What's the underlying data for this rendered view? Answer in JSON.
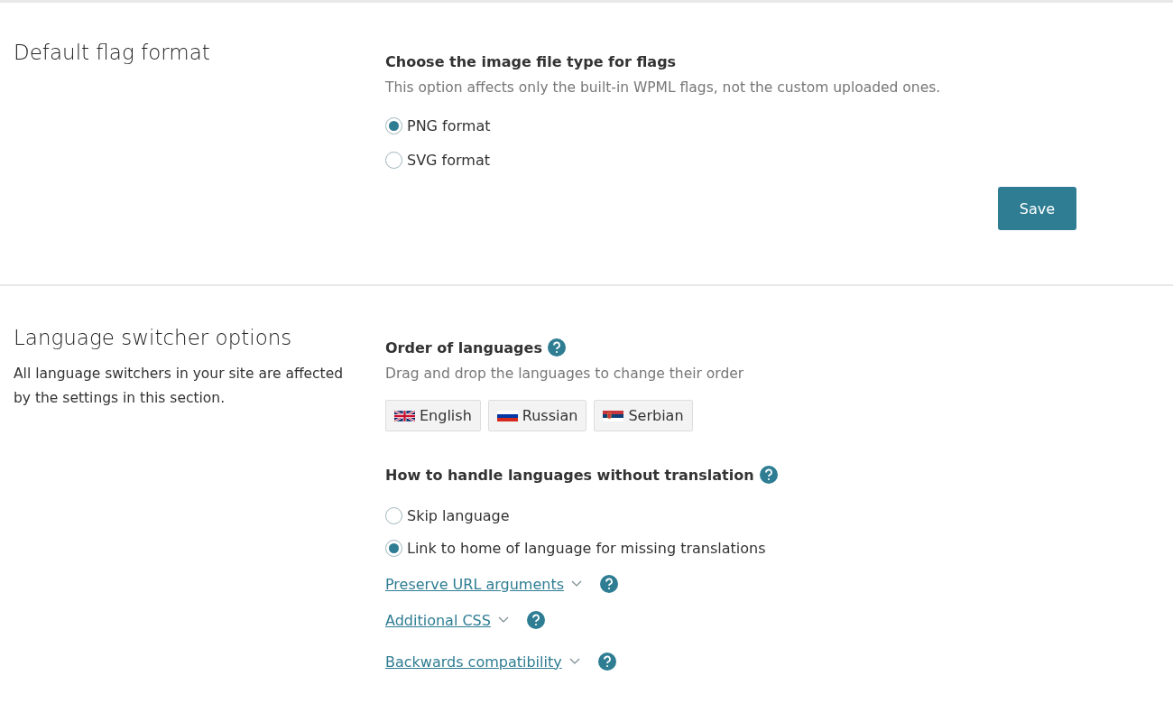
{
  "sections": [
    {
      "title": "Default flag format",
      "kind": "flag_format",
      "heading": "Choose the image file type for flags",
      "hint": "This option affects only the built-in WPML flags, not the custom uploaded ones.",
      "options": [
        {
          "label": "PNG format",
          "selected": true
        },
        {
          "label": "SVG format",
          "selected": false
        }
      ],
      "button": "Save"
    },
    {
      "title": "Language switcher options",
      "description": "All language switchers in your site are affected by the settings in this section.",
      "kind": "switcher",
      "order_heading": "Order of languages",
      "order_hint": "Drag and drop the languages to change their order",
      "languages": [
        {
          "name": "English",
          "kind": "uk"
        },
        {
          "name": "Russian",
          "kind": "ru"
        },
        {
          "name": "Serbian",
          "kind": "rs"
        }
      ],
      "missing_heading": "How to handle languages without translation",
      "options": [
        {
          "label": "Skip language",
          "selected": false
        },
        {
          "label": "Link to home of language for missing translations",
          "selected": true
        }
      ],
      "links": [
        "Preserve URL arguments",
        "Additional CSS",
        "Backwards compatibility"
      ]
    }
  ]
}
